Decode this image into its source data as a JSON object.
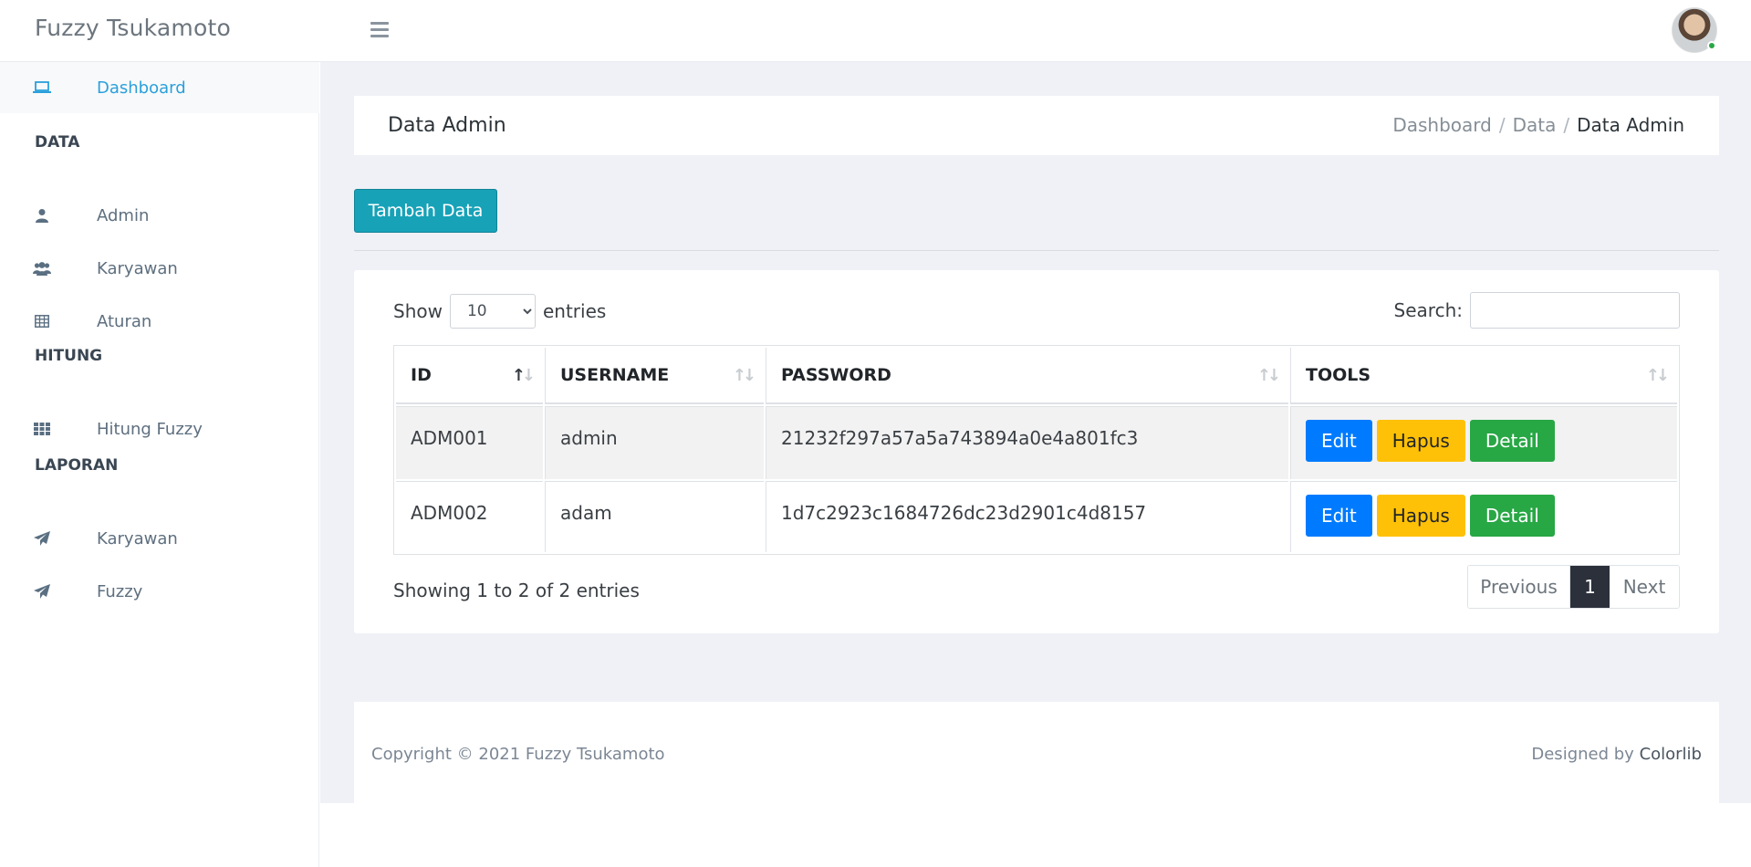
{
  "app": {
    "brand": "Fuzzy Tsukamoto"
  },
  "sidebar": {
    "dashboard": "Dashboard",
    "sections": [
      {
        "heading": "DATA",
        "items": [
          "Admin",
          "Karyawan",
          "Aturan"
        ]
      },
      {
        "heading": "HITUNG",
        "items": [
          "Hitung Fuzzy"
        ]
      },
      {
        "heading": "LAPORAN",
        "items": [
          "Karyawan",
          "Fuzzy"
        ]
      }
    ]
  },
  "page": {
    "title": "Data Admin",
    "breadcrumb": [
      "Dashboard",
      "Data",
      "Data Admin"
    ],
    "breadcrumb_sep": "/",
    "add_button": "Tambah Data"
  },
  "table": {
    "show_label": "Show",
    "entries_value": "10",
    "entries_label": "entries",
    "search_label": "Search:",
    "search_value": "",
    "headers": [
      "ID",
      "USERNAME",
      "PASSWORD",
      "TOOLS"
    ],
    "rows": [
      {
        "id": "ADM001",
        "username": "admin",
        "password": "21232f297a57a5a743894a0e4a801fc3"
      },
      {
        "id": "ADM002",
        "username": "adam",
        "password": "1d7c2923c1684726dc23d2901c4d8157"
      }
    ],
    "tool_labels": {
      "edit": "Edit",
      "hapus": "Hapus",
      "detail": "Detail"
    },
    "info": "Showing 1 to 2 of 2 entries",
    "pagination": {
      "previous": "Previous",
      "current": "1",
      "next": "Next"
    }
  },
  "footer": {
    "copyright": "Copyright © 2021 Fuzzy Tsukamoto",
    "designed_by": "Designed by",
    "designer": "Colorlib"
  },
  "colors": {
    "accent": "#17a2b8",
    "active_link": "#2aa0dc",
    "edit": "#007bff",
    "hapus": "#ffc107",
    "detail": "#28a745"
  }
}
